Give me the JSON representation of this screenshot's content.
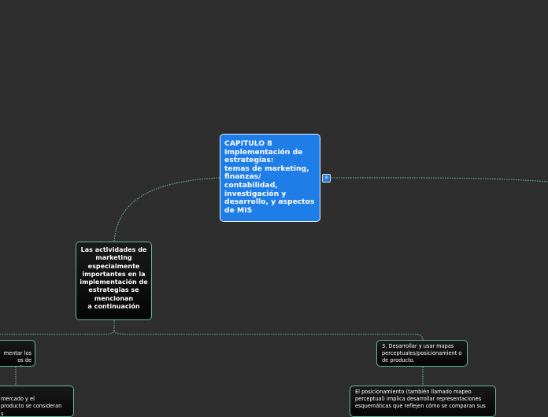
{
  "central_topic": "CAPITULO 8\nImplementación de estrategias:\ntemas de marketing, finanzas/\ncontabilidad,\ninvestigación y desarrollo, y aspectos de MIS",
  "main_topic": "Las actividades de marketing especialmente importantes en la implementación de estrategias se mencionan\na continuación",
  "subtopics": {
    "left_1": "mentar los\nos de\neficaz",
    "left_2": "mercado y el\nproducto se consideran\ns",
    "right_1": "3. Desarrollar y usar mapas perceptuales/posicionamient o de producto.",
    "right_2": "El posicionamiento (también llamado mapeo perceptual) implica desarrollar representaciones esquemáticas que reflejen cómo se comparan sus"
  },
  "icons": {
    "note": "notes-icon"
  },
  "colors": {
    "background": "#2e2e2e",
    "central": "#1f7de8",
    "connector": "#5fb89b"
  }
}
